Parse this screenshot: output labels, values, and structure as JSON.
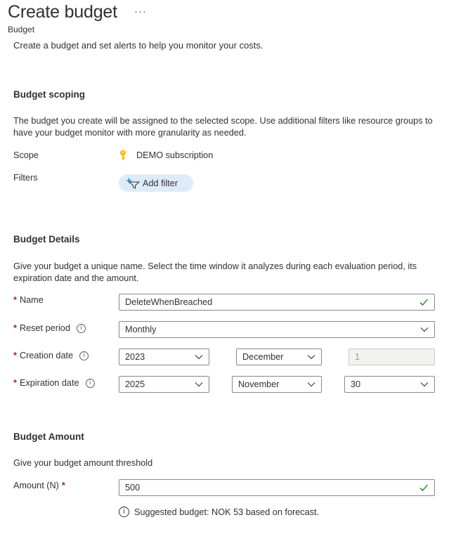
{
  "header": {
    "title": "Create budget",
    "more": "···",
    "subtitle": "Budget"
  },
  "intro": "Create a budget and set alerts to help you monitor your costs.",
  "scoping": {
    "heading": "Budget scoping",
    "description": "The budget you create will be assigned to the selected scope. Use additional filters like resource groups to have your budget monitor with more granularity as needed.",
    "scope_label": "Scope",
    "scope_value": "DEMO subscription",
    "filters_label": "Filters",
    "add_filter": "Add filter"
  },
  "details": {
    "heading": "Budget Details",
    "description": "Give your budget a unique name. Select the time window it analyzes during each evaluation period, its expiration date and the amount.",
    "name_label": "Name",
    "name_value": "DeleteWhenBreached",
    "reset_label": "Reset period",
    "reset_value": "Monthly",
    "creation_label": "Creation date",
    "creation_year": "2023",
    "creation_month": "December",
    "creation_day": "1",
    "expiration_label": "Expiration date",
    "expiration_year": "2025",
    "expiration_month": "November",
    "expiration_day": "30",
    "required_mark": "*",
    "info_glyph": "i"
  },
  "amount": {
    "heading": "Budget Amount",
    "description": "Give your budget amount threshold",
    "label": "Amount (N)",
    "value": "500",
    "suggestion": "Suggested budget: NOK 53 based on forecast."
  },
  "colors": {
    "accent": "#0078d4",
    "required": "#a4262c",
    "valid": "#107c10",
    "key": "#ffb900",
    "pill": "#deecf9"
  },
  "icons": [
    "more-icon",
    "key-icon",
    "filter-icon",
    "chevron-down-icon",
    "checkmark-icon",
    "info-icon"
  ]
}
